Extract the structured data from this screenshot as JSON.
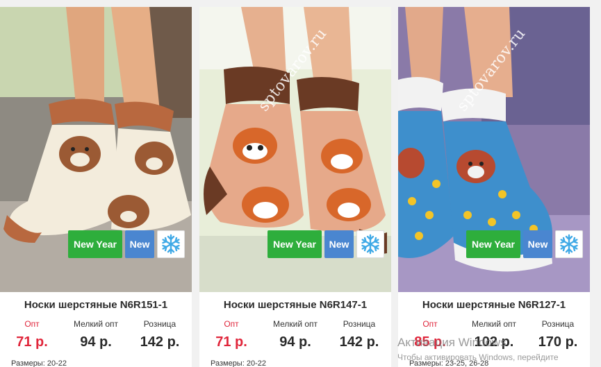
{
  "products": [
    {
      "title": "Носки шерстяные N6R151-1",
      "watermark": "",
      "badges": {
        "new_year": "New Year",
        "new": "New"
      },
      "price_labels": {
        "opt": "Опт",
        "small_opt": "Мелкий опт",
        "retail": "Розница"
      },
      "prices": {
        "opt": "71 р.",
        "small_opt": "94 р.",
        "retail": "142 р."
      },
      "sizes_label": "Размеры:",
      "sizes": "20-22",
      "colors": {
        "sock": "#f3ecdc",
        "cuff": "#b8683f",
        "bg": "#9b8f84"
      }
    },
    {
      "title": "Носки шерстяные N6R147-1",
      "watermark": "sptovarov.ru",
      "badges": {
        "new_year": "New Year",
        "new": "New"
      },
      "price_labels": {
        "opt": "Опт",
        "small_opt": "Мелкий опт",
        "retail": "Розница"
      },
      "prices": {
        "opt": "71 р.",
        "small_opt": "94 р.",
        "retail": "142 р."
      },
      "sizes_label": "Размеры:",
      "sizes": "20-22",
      "colors": {
        "sock": "#e6a98a",
        "cuff": "#6a3a24",
        "bg": "#e8eed9"
      }
    },
    {
      "title": "Носки шерстяные N6R127-1",
      "watermark": "sptovarov.ru",
      "badges": {
        "new_year": "New Year",
        "new": "New"
      },
      "price_labels": {
        "opt": "Опт",
        "small_opt": "Мелкий опт",
        "retail": "Розница"
      },
      "prices": {
        "opt": "85 р.",
        "small_opt": "102 р.",
        "retail": "170 р."
      },
      "sizes_label": "Размеры:",
      "sizes": "23-25, 26-28",
      "colors": {
        "sock": "#3e8fcc",
        "cuff": "#f2f2f2",
        "bg": "#8a7aa8"
      }
    }
  ],
  "windows_activation": {
    "line1": "Активация Windows",
    "line2": "Чтобы активировать Windows, перейдите"
  }
}
